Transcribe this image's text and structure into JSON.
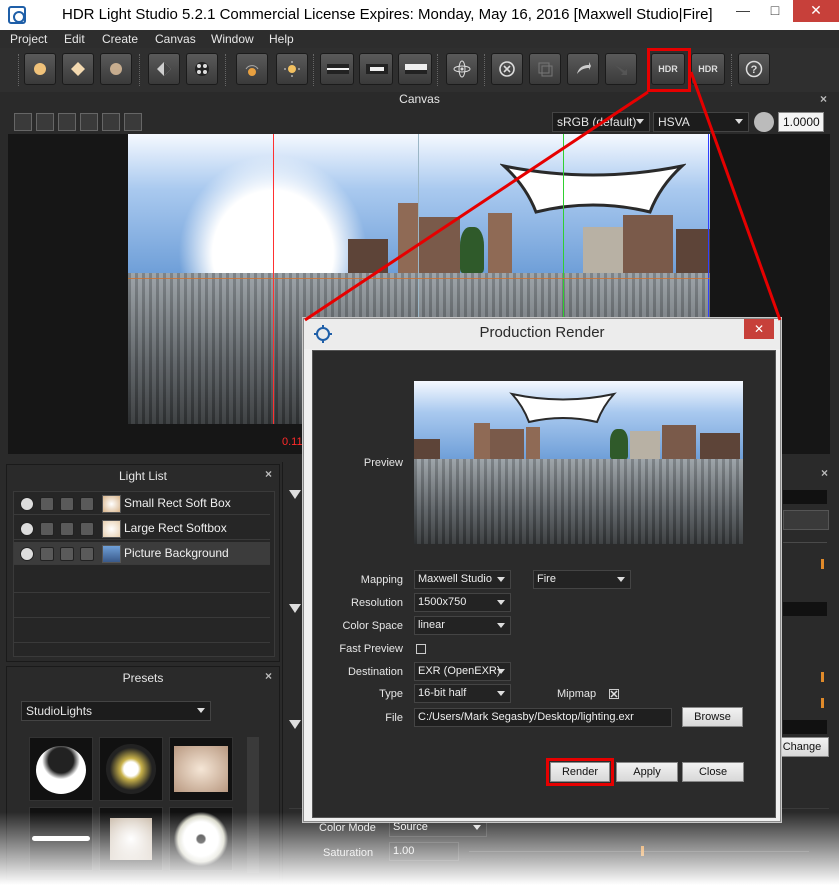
{
  "window": {
    "title": "HDR Light Studio 5.2.1 Commercial License Expires: Monday, May 16, 2016  [Maxwell Studio|Fire]",
    "minimize": "—",
    "maximize": "□",
    "close": "✕"
  },
  "menu": [
    "Project",
    "Edit",
    "Create",
    "Canvas",
    "Window",
    "Help"
  ],
  "toolbar": {
    "hdr_label": "HDR",
    "hdr_label_2": "HDR",
    "help_label": "?",
    "icons": [
      "spot-light-icon",
      "area-light-icon",
      "soft-light-icon",
      "gradient-light-icon",
      "pattern-light-icon",
      "sun-light-icon",
      "sun-sky-icon",
      "rect-gradient-icon",
      "panorama-icon",
      "panorama-wide-icon",
      "atom-icon",
      "delete-icon",
      "crop-icon",
      "undo-icon",
      "redo-icon",
      "hdr-render-icon",
      "hdr-export-icon",
      "help-icon"
    ]
  },
  "canvas": {
    "header": "Canvas",
    "close": "×",
    "color_profile": "sRGB (default)",
    "color_mode": "HSVA",
    "exposure": "1.0000",
    "coord_label": "0.11"
  },
  "light_list": {
    "header": "Light List",
    "close": "×",
    "items": [
      {
        "name": "Small Rect Soft Box",
        "thumb_color": "#d8b48a"
      },
      {
        "name": "Large Rect Softbox",
        "thumb_color": "#e8d0b0"
      },
      {
        "name": "Picture Background",
        "thumb_color": "#3a5a8a"
      }
    ]
  },
  "presets": {
    "header": "Presets",
    "close": "×",
    "category": "StudioLights"
  },
  "right_panel": {
    "change_button": "Change",
    "color_mode_label": "Color Mode",
    "color_mode_value": "Source",
    "saturation_label": "Saturation",
    "saturation_value": "1.00"
  },
  "dialog": {
    "title": "Production Render",
    "close": "✕",
    "preview_label": "Preview",
    "mapping_label": "Mapping",
    "mapping_value": "Maxwell Studio",
    "mapping_sub_value": "Fire",
    "resolution_label": "Resolution",
    "resolution_value": "1500x750",
    "color_space_label": "Color Space",
    "color_space_value": "linear",
    "fast_preview_label": "Fast Preview",
    "fast_preview_checked": false,
    "destination_label": "Destination",
    "destination_value": "EXR (OpenEXR)",
    "type_label": "Type",
    "type_value": "16-bit half",
    "mipmap_label": "Mipmap",
    "mipmap_checked": true,
    "file_label": "File",
    "file_value": "C:/Users/Mark Segasby/Desktop/lighting.exr",
    "browse_button": "Browse",
    "render_button": "Render",
    "apply_button": "Apply",
    "close_button": "Close"
  },
  "colors": {
    "highlight_red": "#e60000",
    "ui_dark": "#2a2a2a",
    "slider_accent": "#e08a2a"
  }
}
